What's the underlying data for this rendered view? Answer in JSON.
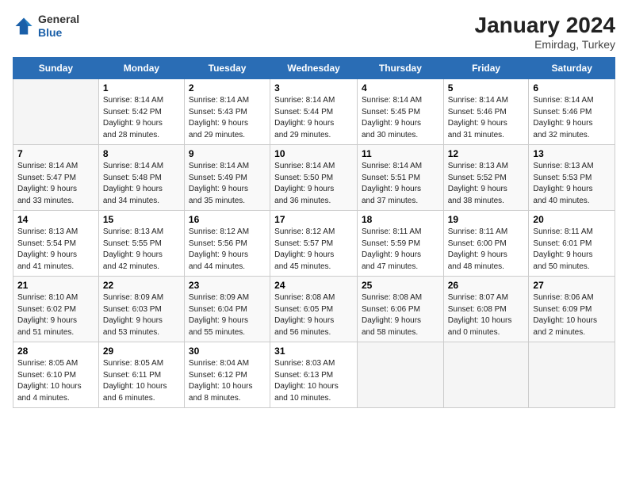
{
  "logo": {
    "line1": "General",
    "line2": "Blue"
  },
  "title": "January 2024",
  "location": "Emirdag, Turkey",
  "days_header": [
    "Sunday",
    "Monday",
    "Tuesday",
    "Wednesday",
    "Thursday",
    "Friday",
    "Saturday"
  ],
  "weeks": [
    [
      {
        "num": "",
        "info": ""
      },
      {
        "num": "1",
        "info": "Sunrise: 8:14 AM\nSunset: 5:42 PM\nDaylight: 9 hours\nand 28 minutes."
      },
      {
        "num": "2",
        "info": "Sunrise: 8:14 AM\nSunset: 5:43 PM\nDaylight: 9 hours\nand 29 minutes."
      },
      {
        "num": "3",
        "info": "Sunrise: 8:14 AM\nSunset: 5:44 PM\nDaylight: 9 hours\nand 29 minutes."
      },
      {
        "num": "4",
        "info": "Sunrise: 8:14 AM\nSunset: 5:45 PM\nDaylight: 9 hours\nand 30 minutes."
      },
      {
        "num": "5",
        "info": "Sunrise: 8:14 AM\nSunset: 5:46 PM\nDaylight: 9 hours\nand 31 minutes."
      },
      {
        "num": "6",
        "info": "Sunrise: 8:14 AM\nSunset: 5:46 PM\nDaylight: 9 hours\nand 32 minutes."
      }
    ],
    [
      {
        "num": "7",
        "info": "Sunrise: 8:14 AM\nSunset: 5:47 PM\nDaylight: 9 hours\nand 33 minutes."
      },
      {
        "num": "8",
        "info": "Sunrise: 8:14 AM\nSunset: 5:48 PM\nDaylight: 9 hours\nand 34 minutes."
      },
      {
        "num": "9",
        "info": "Sunrise: 8:14 AM\nSunset: 5:49 PM\nDaylight: 9 hours\nand 35 minutes."
      },
      {
        "num": "10",
        "info": "Sunrise: 8:14 AM\nSunset: 5:50 PM\nDaylight: 9 hours\nand 36 minutes."
      },
      {
        "num": "11",
        "info": "Sunrise: 8:14 AM\nSunset: 5:51 PM\nDaylight: 9 hours\nand 37 minutes."
      },
      {
        "num": "12",
        "info": "Sunrise: 8:13 AM\nSunset: 5:52 PM\nDaylight: 9 hours\nand 38 minutes."
      },
      {
        "num": "13",
        "info": "Sunrise: 8:13 AM\nSunset: 5:53 PM\nDaylight: 9 hours\nand 40 minutes."
      }
    ],
    [
      {
        "num": "14",
        "info": "Sunrise: 8:13 AM\nSunset: 5:54 PM\nDaylight: 9 hours\nand 41 minutes."
      },
      {
        "num": "15",
        "info": "Sunrise: 8:13 AM\nSunset: 5:55 PM\nDaylight: 9 hours\nand 42 minutes."
      },
      {
        "num": "16",
        "info": "Sunrise: 8:12 AM\nSunset: 5:56 PM\nDaylight: 9 hours\nand 44 minutes."
      },
      {
        "num": "17",
        "info": "Sunrise: 8:12 AM\nSunset: 5:57 PM\nDaylight: 9 hours\nand 45 minutes."
      },
      {
        "num": "18",
        "info": "Sunrise: 8:11 AM\nSunset: 5:59 PM\nDaylight: 9 hours\nand 47 minutes."
      },
      {
        "num": "19",
        "info": "Sunrise: 8:11 AM\nSunset: 6:00 PM\nDaylight: 9 hours\nand 48 minutes."
      },
      {
        "num": "20",
        "info": "Sunrise: 8:11 AM\nSunset: 6:01 PM\nDaylight: 9 hours\nand 50 minutes."
      }
    ],
    [
      {
        "num": "21",
        "info": "Sunrise: 8:10 AM\nSunset: 6:02 PM\nDaylight: 9 hours\nand 51 minutes."
      },
      {
        "num": "22",
        "info": "Sunrise: 8:09 AM\nSunset: 6:03 PM\nDaylight: 9 hours\nand 53 minutes."
      },
      {
        "num": "23",
        "info": "Sunrise: 8:09 AM\nSunset: 6:04 PM\nDaylight: 9 hours\nand 55 minutes."
      },
      {
        "num": "24",
        "info": "Sunrise: 8:08 AM\nSunset: 6:05 PM\nDaylight: 9 hours\nand 56 minutes."
      },
      {
        "num": "25",
        "info": "Sunrise: 8:08 AM\nSunset: 6:06 PM\nDaylight: 9 hours\nand 58 minutes."
      },
      {
        "num": "26",
        "info": "Sunrise: 8:07 AM\nSunset: 6:08 PM\nDaylight: 10 hours\nand 0 minutes."
      },
      {
        "num": "27",
        "info": "Sunrise: 8:06 AM\nSunset: 6:09 PM\nDaylight: 10 hours\nand 2 minutes."
      }
    ],
    [
      {
        "num": "28",
        "info": "Sunrise: 8:05 AM\nSunset: 6:10 PM\nDaylight: 10 hours\nand 4 minutes."
      },
      {
        "num": "29",
        "info": "Sunrise: 8:05 AM\nSunset: 6:11 PM\nDaylight: 10 hours\nand 6 minutes."
      },
      {
        "num": "30",
        "info": "Sunrise: 8:04 AM\nSunset: 6:12 PM\nDaylight: 10 hours\nand 8 minutes."
      },
      {
        "num": "31",
        "info": "Sunrise: 8:03 AM\nSunset: 6:13 PM\nDaylight: 10 hours\nand 10 minutes."
      },
      {
        "num": "",
        "info": ""
      },
      {
        "num": "",
        "info": ""
      },
      {
        "num": "",
        "info": ""
      }
    ]
  ]
}
